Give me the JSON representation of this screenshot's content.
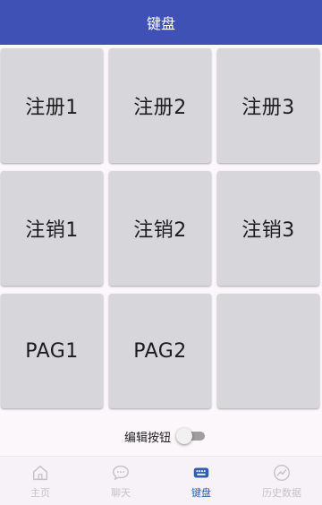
{
  "app_bar": {
    "title": "键盘"
  },
  "keys": [
    {
      "label": "注册1"
    },
    {
      "label": "注册2"
    },
    {
      "label": "注册3"
    },
    {
      "label": "注销1"
    },
    {
      "label": "注销2"
    },
    {
      "label": "注销3"
    },
    {
      "label": "PAG1"
    },
    {
      "label": "PAG2"
    },
    {
      "label": ""
    }
  ],
  "edit_toggle": {
    "label": "编辑按钮",
    "on": false
  },
  "bottom_nav": {
    "items": [
      {
        "label": "主页",
        "icon": "home-icon"
      },
      {
        "label": "聊天",
        "icon": "chat-bubble-icon"
      },
      {
        "label": "键盘",
        "icon": "keyboard-icon",
        "active": true
      },
      {
        "label": "历史数据",
        "icon": "chart-line-icon"
      }
    ]
  },
  "colors": {
    "app_bar": "#3f51b5",
    "key_bg": "#d7d6da",
    "nav_active": "#2f5fb0",
    "nav_inactive": "#c7c2c8"
  }
}
